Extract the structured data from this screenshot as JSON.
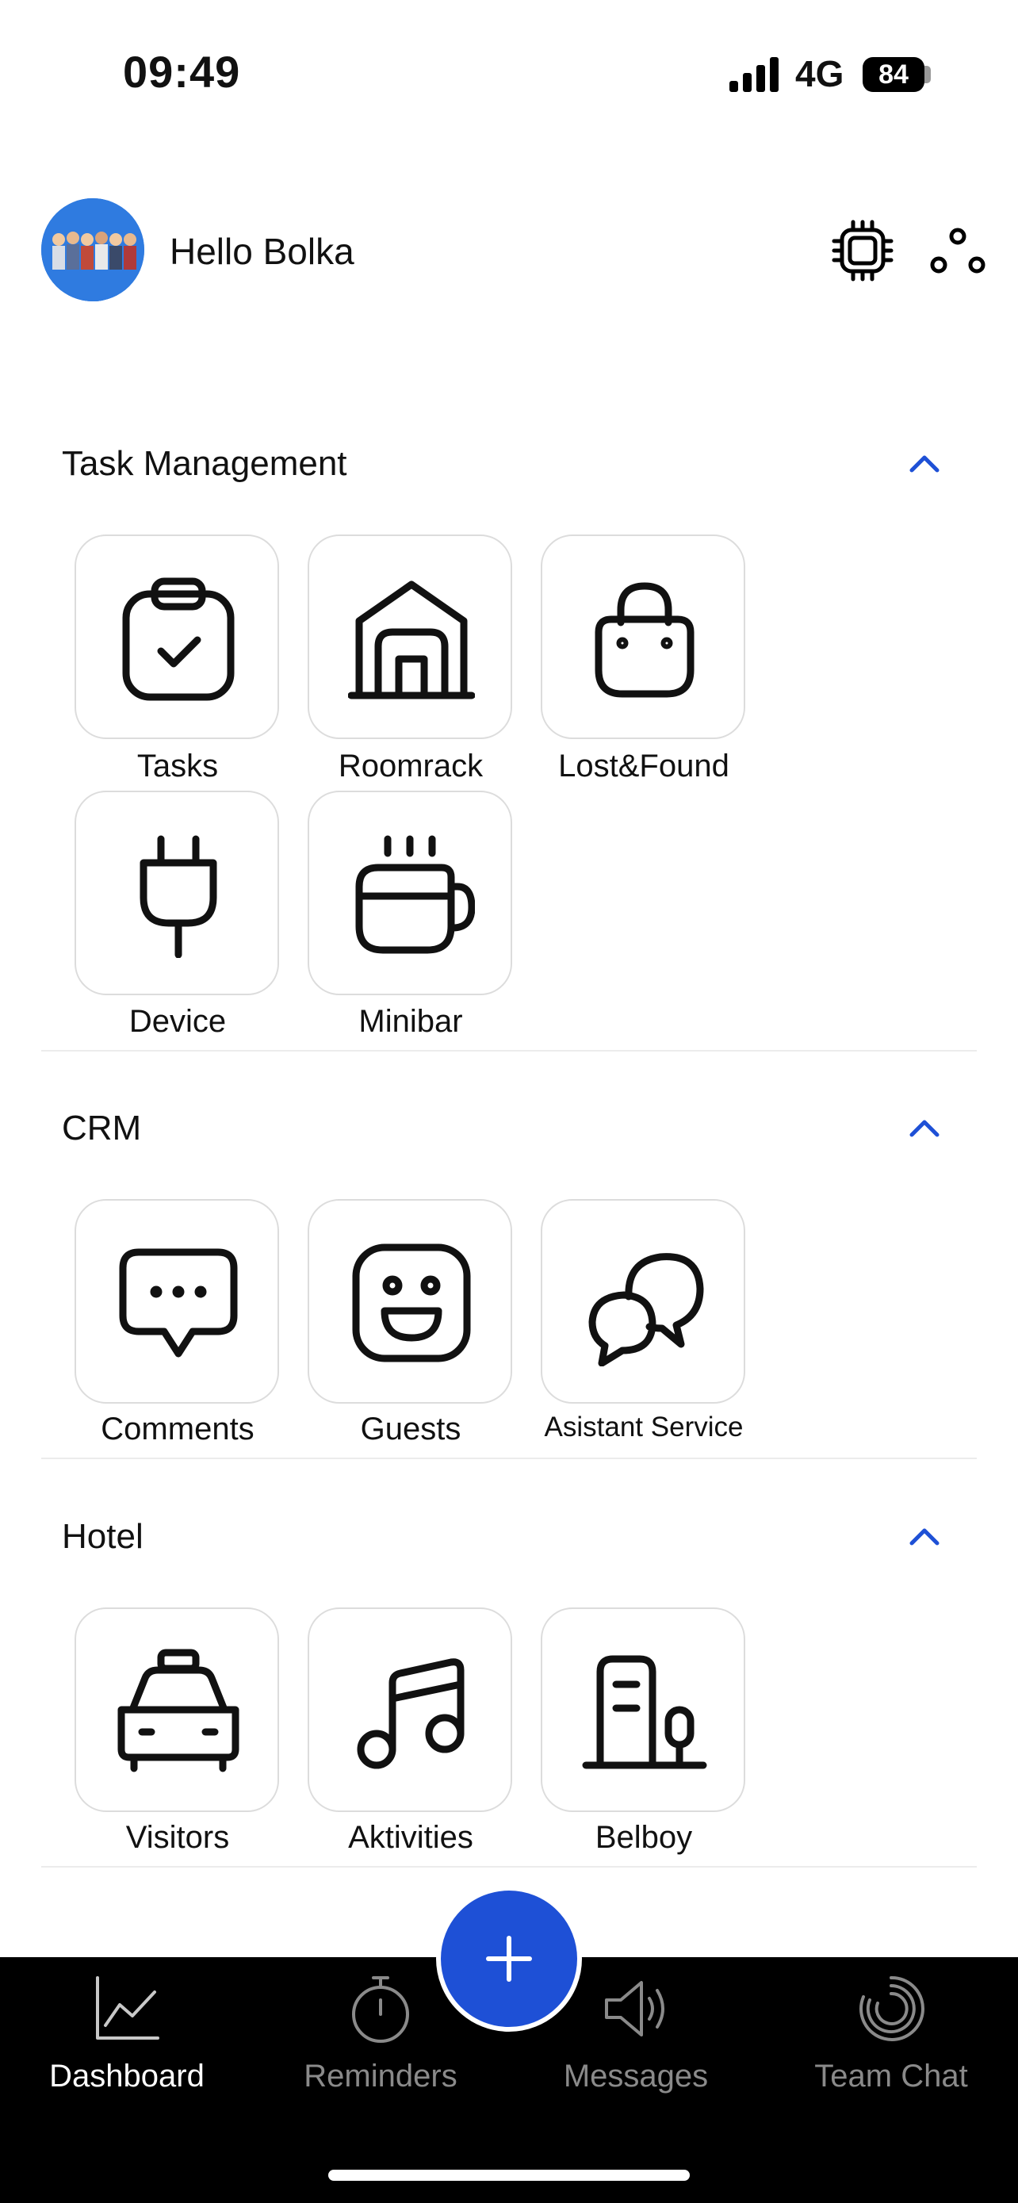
{
  "status_bar": {
    "time": "09:49",
    "network": "4G",
    "battery": "84"
  },
  "header": {
    "greeting": "Hello Bolka",
    "chip_icon": "chip-icon",
    "share_icon": "share-icon"
  },
  "sections": [
    {
      "title": "Task Management",
      "items": [
        {
          "label": "Tasks",
          "icon": "clipboard-check-icon"
        },
        {
          "label": "Roomrack",
          "icon": "warehouse-icon"
        },
        {
          "label": "Lost&Found",
          "icon": "bag-icon"
        },
        {
          "label": "Device",
          "icon": "plug-icon"
        },
        {
          "label": "Minibar",
          "icon": "coffee-cup-icon"
        }
      ]
    },
    {
      "title": "CRM",
      "items": [
        {
          "label": "Comments",
          "icon": "chat-dots-icon"
        },
        {
          "label": "Guests",
          "icon": "smiley-icon"
        },
        {
          "label": "Asistant Service",
          "icon": "chat-bubbles-icon"
        }
      ]
    },
    {
      "title": "Hotel",
      "items": [
        {
          "label": "Visitors",
          "icon": "taxi-icon"
        },
        {
          "label": "Aktivities",
          "icon": "music-note-icon"
        },
        {
          "label": "Belboy",
          "icon": "building-tree-icon"
        }
      ]
    }
  ],
  "nav": [
    {
      "label": "Dashboard",
      "icon": "chart-line-icon",
      "active": true
    },
    {
      "label": "Reminders",
      "icon": "stopwatch-icon"
    },
    {
      "label": "Messages",
      "icon": "speaker-icon"
    },
    {
      "label": "Team Chat",
      "icon": "spiral-icon"
    }
  ],
  "fab": {
    "icon": "plus-icon"
  },
  "colors": {
    "accent": "#1e50d6",
    "nav_bg": "#000000",
    "tile_border": "#dcdcdc"
  }
}
